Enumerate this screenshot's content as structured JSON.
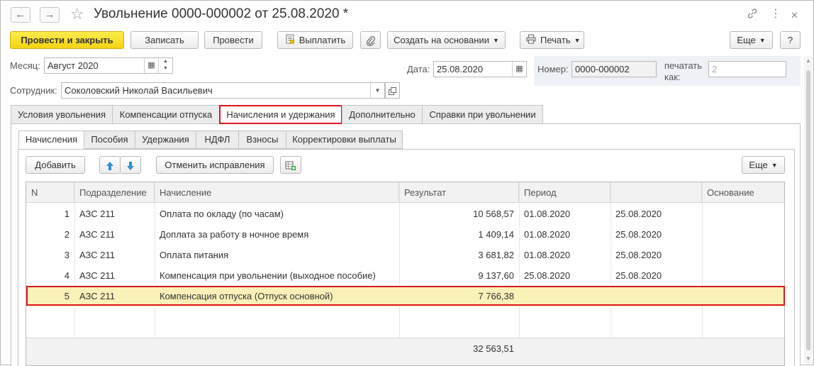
{
  "title": "Увольнение 0000-000002 от 25.08.2020 *",
  "toolbar": {
    "post_and_close": "Провести и закрыть",
    "save": "Записать",
    "post": "Провести",
    "pay": "Выплатить",
    "create_based_on": "Создать на основании",
    "print": "Печать",
    "more": "Еще",
    "help": "?"
  },
  "form": {
    "month_label": "Месяц:",
    "month_value": "Август 2020",
    "date_label": "Дата:",
    "date_value": "25.08.2020",
    "number_label": "Номер:",
    "number_value": "0000-000002",
    "print_as_label_1": "печатать",
    "print_as_label_2": "как:",
    "print_as_value": "2",
    "employee_label": "Сотрудник:",
    "employee_value": "Соколовский Николай Васильевич"
  },
  "tabs": [
    "Условия увольнения",
    "Компенсации отпуска",
    "Начисления и удержания",
    "Дополнительно",
    "Справки при увольнении"
  ],
  "subtabs": [
    "Начисления",
    "Пособия",
    "Удержания",
    "НДФЛ",
    "Взносы",
    "Корректировки выплаты"
  ],
  "grid_toolbar": {
    "add": "Добавить",
    "cancel_corrections": "Отменить исправления",
    "more": "Еще"
  },
  "table": {
    "headers": [
      "N",
      "Подразделение",
      "Начисление",
      "Результат",
      "Период",
      "",
      "Основание"
    ],
    "rows": [
      {
        "n": "1",
        "dept": "АЗС 211",
        "accrual": "Оплата по окладу (по часам)",
        "result": "10 568,57",
        "from": "01.08.2020",
        "to": "25.08.2020",
        "basis": ""
      },
      {
        "n": "2",
        "dept": "АЗС 211",
        "accrual": "Доплата за работу в ночное время",
        "result": "1 409,14",
        "from": "01.08.2020",
        "to": "25.08.2020",
        "basis": ""
      },
      {
        "n": "3",
        "dept": "АЗС 211",
        "accrual": "Оплата питания",
        "result": "3 681,82",
        "from": "01.08.2020",
        "to": "25.08.2020",
        "basis": ""
      },
      {
        "n": "4",
        "dept": "АЗС 211",
        "accrual": "Компенсация при увольнении (выходное пособие)",
        "result": "9 137,60",
        "from": "25.08.2020",
        "to": "25.08.2020",
        "basis": ""
      },
      {
        "n": "5",
        "dept": "АЗС 211",
        "accrual": "Компенсация отпуска (Отпуск основной)",
        "result": "7 766,38",
        "from": "",
        "to": "",
        "basis": ""
      }
    ],
    "total": "32 563,51"
  },
  "colors": {
    "accent_red": "#d9181f",
    "primary_yellow": "#f5d312",
    "selected_row": "#fbf1b8"
  }
}
